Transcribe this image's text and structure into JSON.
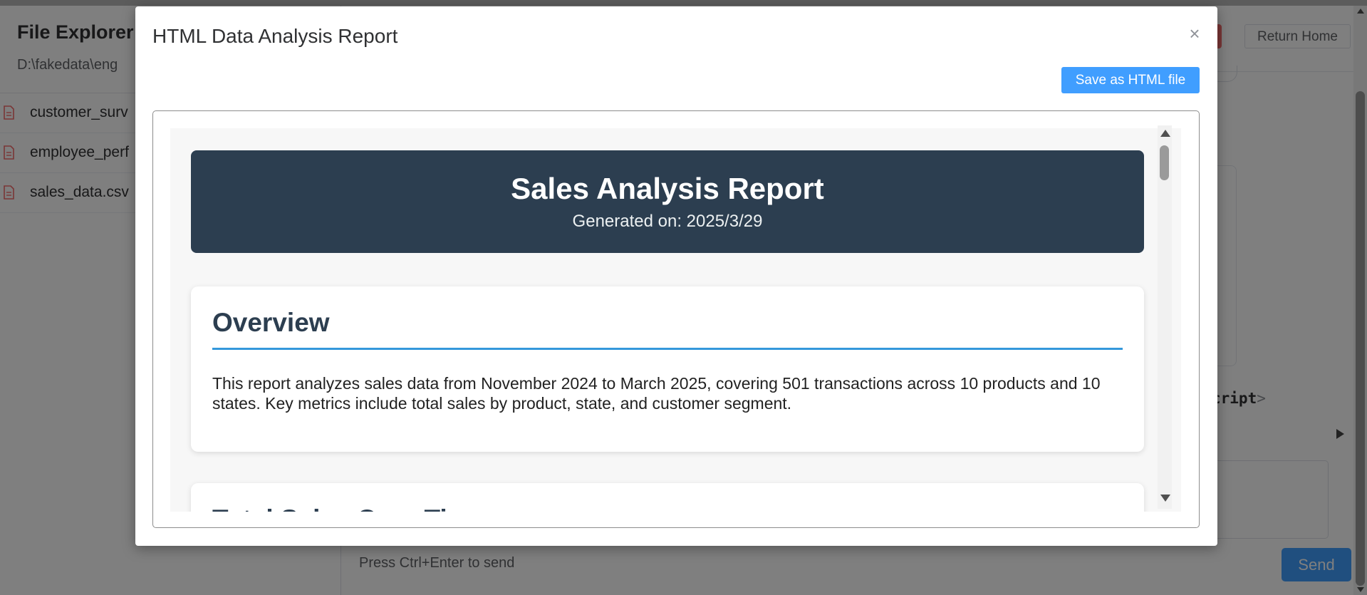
{
  "background": {
    "file_explorer": {
      "title": "File Explorer",
      "path": "D:\\fakedata\\eng",
      "files": [
        {
          "name": "customer_surv"
        },
        {
          "name": "employee_perf"
        },
        {
          "name": "sales_data.csv"
        }
      ]
    },
    "header": {
      "return_home_label": "Return Home"
    },
    "code_snippet": "cript",
    "chat": {
      "hint": "Press Ctrl+Enter to send",
      "send_label": "Send"
    }
  },
  "modal": {
    "title": "HTML Data Analysis Report",
    "close_glyph": "×",
    "save_button_label": "Save as HTML file",
    "report": {
      "title": "Sales Analysis Report",
      "generated": "Generated on: 2025/3/29",
      "sections": [
        {
          "heading": "Overview",
          "text": "This report analyzes sales data from November 2024 to March 2025, covering 501 transactions across 10 products and 10 states. Key metrics include total sales by product, state, and customer segment."
        },
        {
          "heading": "Total Sales Over Time"
        }
      ]
    }
  },
  "colors": {
    "accent": "#409eff",
    "banner": "#2c3e50",
    "rule": "#3498db",
    "file_icon": "#f56c6c"
  }
}
